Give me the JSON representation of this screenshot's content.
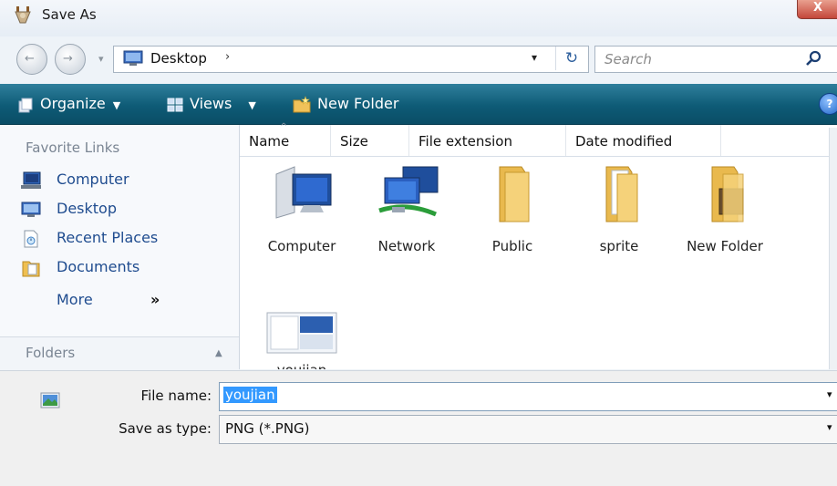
{
  "window": {
    "title": "Save As",
    "close_glyph": "X"
  },
  "address": {
    "location_label": "Desktop",
    "separator_glyph": "›",
    "dropdown_glyph": "▾",
    "refresh_glyph": "↻",
    "back_glyph": "←",
    "forward_glyph": "→",
    "history_glyph": "▾"
  },
  "search": {
    "placeholder": "Search"
  },
  "toolbar": {
    "organize_label": "Organize",
    "views_label": "Views",
    "new_folder_label": "New Folder",
    "caret_glyph": "▼",
    "help_glyph": "?"
  },
  "sidebar": {
    "favorites_title": "Favorite Links",
    "links": [
      {
        "label": "Computer",
        "icon": "computer-icon"
      },
      {
        "label": "Desktop",
        "icon": "desktop-icon"
      },
      {
        "label": "Recent Places",
        "icon": "recent-places-icon"
      },
      {
        "label": "Documents",
        "icon": "documents-icon"
      }
    ],
    "more_label": "More",
    "more_glyph": "»",
    "folders_title": "Folders",
    "folders_caret": "▲"
  },
  "columns": [
    "Name",
    "Size",
    "File extension",
    "Date modified"
  ],
  "sort_glyph": "^",
  "items": [
    {
      "name": "Computer",
      "icon": "computer-icon"
    },
    {
      "name": "Network",
      "icon": "network-icon"
    },
    {
      "name": "Public",
      "icon": "folder-icon"
    },
    {
      "name": "sprite",
      "icon": "folder-icon"
    },
    {
      "name": "New Folder",
      "icon": "folder-icon"
    },
    {
      "name": "youjian",
      "icon": "image-file-icon"
    }
  ],
  "footer": {
    "file_name_label": "File name:",
    "file_name_value": "youjian",
    "save_type_label": "Save as type:",
    "save_type_value": "PNG (*.PNG)",
    "dropdown_glyph": "▾"
  },
  "colors": {
    "toolbar": "#0e5b76",
    "link": "#1f4c8f",
    "selection": "#3399ff"
  }
}
